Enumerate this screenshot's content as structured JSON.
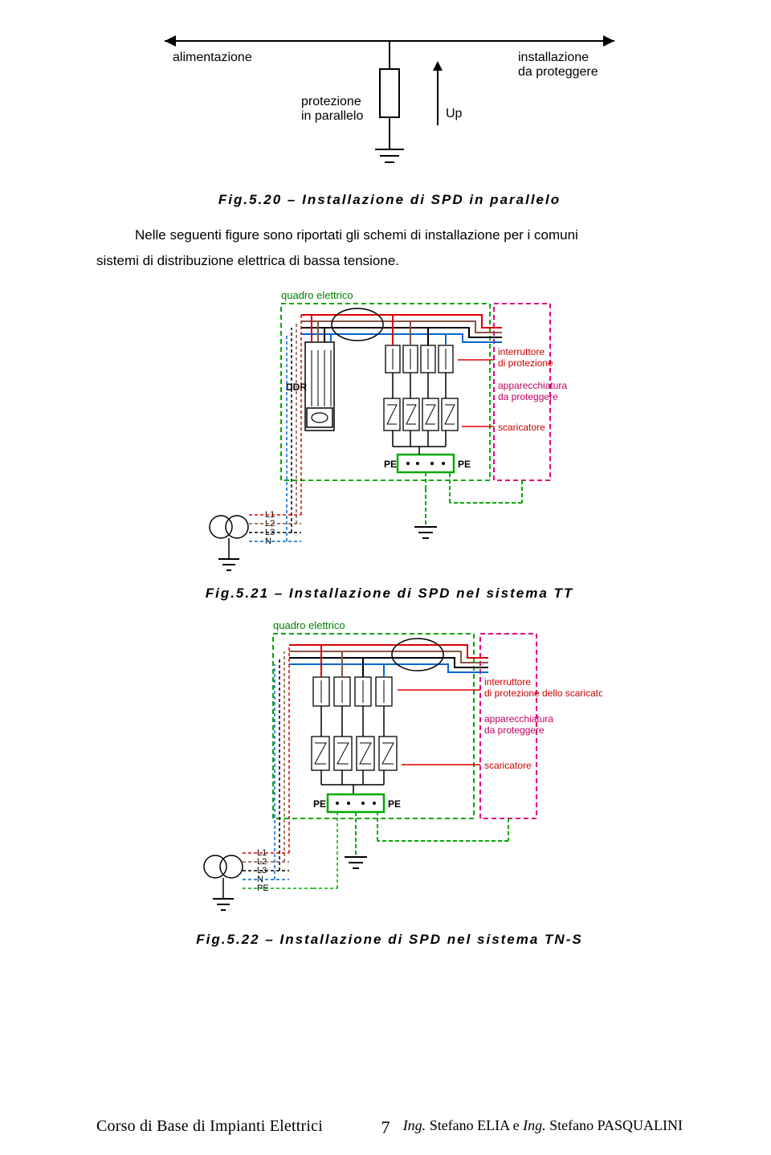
{
  "fig520": {
    "caption": "Fig.5.20 – Installazione di SPD in parallelo",
    "labels": {
      "alimentazione": "alimentazione",
      "installazione": "installazione",
      "da_proteggere": "da proteggere",
      "protezione": "protezione",
      "in_parallelo": "in parallelo",
      "up": "Up"
    }
  },
  "paragraph": {
    "line1_part1": "Nelle seguenti figure sono riportati gli schemi di installazione per i comuni",
    "line2": "sistemi di distribuzione elettrica di bassa tensione."
  },
  "fig521": {
    "caption": "Fig.5.21 – Installazione di SPD nel sistema TT",
    "labels": {
      "quadro": "quadro elettrico",
      "ddr": "DDR",
      "interruttore": "interruttore",
      "di_protezione": "di protezione",
      "apparecchiatura": "apparecchiatura",
      "da_proteggere": "da proteggere",
      "scaricatore": "scaricatore",
      "pe1": "PE",
      "pe2": "PE",
      "l1": "L1",
      "l2": "L2",
      "l3": "L3",
      "n": "N"
    }
  },
  "fig522": {
    "caption": "Fig.5.22 – Installazione di SPD nel sistema TN-S",
    "labels": {
      "quadro": "quadro elettrico",
      "interruttore": "interruttore",
      "di_protezione_scaricatore": "di protezione dello scaricatore",
      "apparecchiatura": "apparecchiatura",
      "da_proteggere": "da proteggere",
      "scaricatore": "scaricatore",
      "pe1": "PE",
      "pe2": "PE",
      "l1": "L1",
      "l2": "L2",
      "l3": "L3",
      "n": "N",
      "pe_line": "PE"
    }
  },
  "footer": {
    "left": "Corso di Base di Impianti Elettrici",
    "page": "7",
    "right_ing1": "Ing.",
    "right_name1": " Stefano  ELIA e ",
    "right_ing2": "Ing.",
    "right_name2": " Stefano PASQUALINI"
  }
}
